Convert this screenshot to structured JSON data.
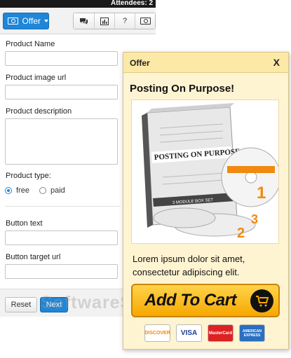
{
  "topbar": {
    "attendees": "Attendees: 2"
  },
  "toolbar": {
    "offer_label": "Offer",
    "help_label": "?",
    "icons": [
      "cash-icon",
      "chat-icon",
      "chart-icon",
      "help-icon",
      "cash-icon"
    ]
  },
  "form": {
    "product_name_label": "Product Name",
    "product_image_label": "Product image url",
    "product_desc_label": "Product description",
    "product_type_label": "Product type:",
    "type_free": "free",
    "type_paid": "paid",
    "selected_type": "free",
    "button_text_label": "Button text",
    "button_url_label": "Button target url"
  },
  "footer": {
    "reset": "Reset",
    "next": "Next"
  },
  "watermark": "SoftwareSuggest",
  "popup": {
    "title": "Offer",
    "close": "X",
    "heading": "Posting On Purpose!",
    "description": "Lorem ipsum dolor sit amet, consectetur adipiscing elit.",
    "product_box_title": "POSTING ON PURPOSE",
    "product_box_sub": "3 MODULE BOX SET",
    "cart_button": "Add To Cart",
    "cards": [
      "DISCOVER",
      "VISA",
      "MasterCard",
      "AMERICAN EXPRESS"
    ]
  },
  "colors": {
    "primary": "#1f86d8",
    "popup_bg": "#fff4d2",
    "popup_header": "#fce9a7",
    "cart": "#f6a800"
  }
}
